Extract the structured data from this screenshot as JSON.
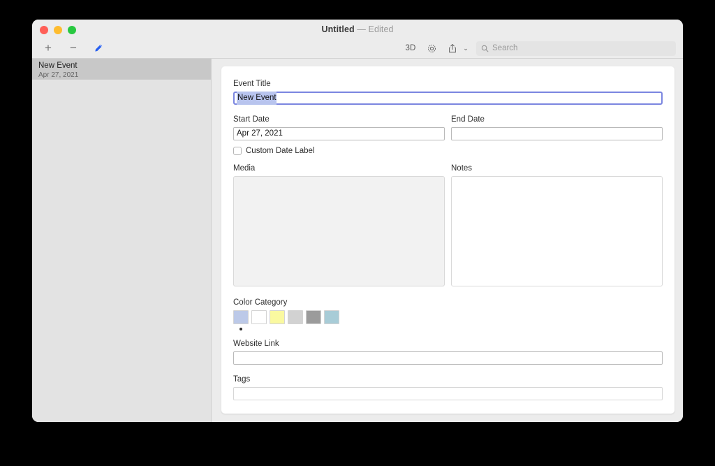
{
  "window": {
    "title": "Untitled",
    "subtitle": "— Edited"
  },
  "toolbar": {
    "add_label": "+",
    "remove_label": "−",
    "edit_icon": "pencil-icon",
    "three_d_label": "3D",
    "settings_icon": "gear-icon",
    "share_icon": "share-icon",
    "share_chevron": "⌄",
    "search_icon": "search-icon",
    "search_placeholder": "Search",
    "search_value": ""
  },
  "sidebar": {
    "items": [
      {
        "title": "New Event",
        "subtitle": "Apr 27, 2021",
        "selected": true
      }
    ]
  },
  "form": {
    "event_title": {
      "label": "Event Title",
      "value": "New Event"
    },
    "start_date": {
      "label": "Start Date",
      "value": "Apr 27, 2021"
    },
    "end_date": {
      "label": "End Date",
      "value": ""
    },
    "custom_date_label": {
      "label": "Custom Date Label",
      "checked": false
    },
    "media": {
      "label": "Media"
    },
    "notes": {
      "label": "Notes",
      "value": ""
    },
    "color_category": {
      "label": "Color Category",
      "swatches": [
        {
          "name": "light-blue",
          "color": "#bcc9e8",
          "selected": true
        },
        {
          "name": "white",
          "color": "#ffffff",
          "selected": false
        },
        {
          "name": "pale-yellow",
          "color": "#faf9a0",
          "selected": false
        },
        {
          "name": "light-gray",
          "color": "#d2d2d2",
          "selected": false
        },
        {
          "name": "medium-gray",
          "color": "#9b9b9b",
          "selected": false
        },
        {
          "name": "blue-gray",
          "color": "#a8ccd7",
          "selected": false
        }
      ]
    },
    "website_link": {
      "label": "Website Link",
      "value": ""
    },
    "tags": {
      "label": "Tags",
      "value": ""
    }
  },
  "colors": {
    "focus_ring": "#7b86e0",
    "selection_highlight": "#b8c4ee",
    "accent_blue": "#2860f0",
    "window_chrome": "#ececec",
    "sidebar_bg": "#e3e3e3",
    "sidebar_selected": "#c8c8c8"
  }
}
